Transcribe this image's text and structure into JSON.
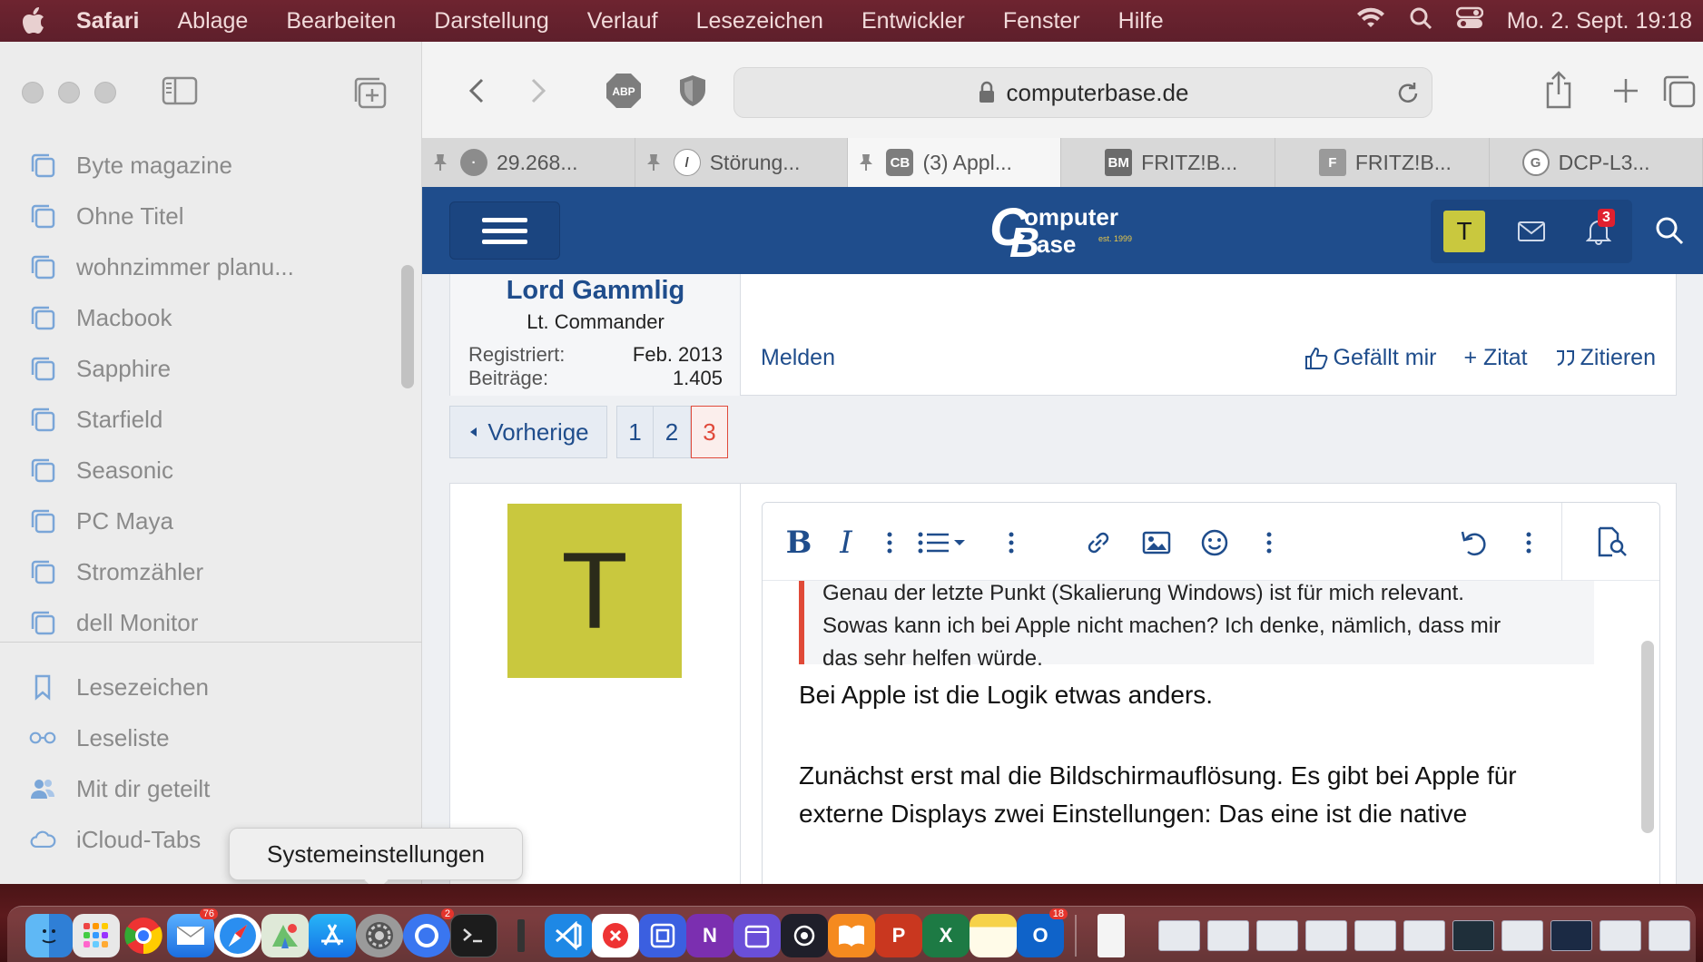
{
  "menubar": {
    "app": "Safari",
    "items": [
      "Ablage",
      "Bearbeiten",
      "Darstellung",
      "Verlauf",
      "Lesezeichen",
      "Entwickler",
      "Fenster",
      "Hilfe"
    ],
    "clock": "Mo. 2. Sept. 19:18"
  },
  "sidebar": {
    "tab_groups": [
      "Byte magazine",
      "Ohne Titel",
      "wohnzimmer planu...",
      "Macbook",
      "Sapphire",
      "Starfield",
      "Seasonic",
      "PC Maya",
      "Stromzähler",
      "dell  Monitor"
    ],
    "lower": [
      {
        "label": "Lesezeichen",
        "icon": "bookmark-icon"
      },
      {
        "label": "Leseliste",
        "icon": "glasses-icon"
      },
      {
        "label": "Mit dir geteilt",
        "icon": "shared-people-icon"
      },
      {
        "label": "iCloud-Tabs",
        "icon": "cloud-icon"
      }
    ],
    "tooltip": "Systemeinstellungen"
  },
  "toolbar": {
    "url": "computerbase.de",
    "abp_label": "ABP"
  },
  "tabs": [
    {
      "label": "29.268...",
      "pinned": true,
      "favicon": "·"
    },
    {
      "label": "Störung...",
      "pinned": true,
      "favicon": "/"
    },
    {
      "label": "(3) Appl...",
      "pinned": true,
      "favicon": "CB",
      "active": true
    },
    {
      "label": "FRITZ!B...",
      "pinned": false,
      "favicon": "BM"
    },
    {
      "label": "FRITZ!B...",
      "pinned": false,
      "favicon": "F"
    },
    {
      "label": "DCP-L3...",
      "pinned": false,
      "favicon": "G"
    }
  ],
  "site": {
    "logo_big_c": "C",
    "logo_omputer": "omputer",
    "logo_big_b": "B",
    "logo_ase": "ase",
    "logo_est": "est. 1999",
    "user_initial": "T",
    "notification_count": "3"
  },
  "post": {
    "author": "Lord Gammlig",
    "rank": "Lt. Commander",
    "registered_label": "Registriert:",
    "registered_value": "Feb. 2013",
    "posts_label": "Beiträge:",
    "posts_value": "1.405",
    "report": "Melden",
    "like": "Gefällt mir",
    "quote_add": "+ Zitat",
    "quote": "Zitieren"
  },
  "pagination": {
    "prev": "Vorherige",
    "pages": [
      "1",
      "2",
      "3"
    ],
    "current": "3"
  },
  "reply": {
    "avatar_initial": "T",
    "quote_lines": [
      "Genau der letzte Punkt (Skalierung Windows) ist für mich relevant.",
      "Sowas kann ich bei Apple nicht machen? Ich denke, nämlich, dass mir",
      "das sehr helfen würde."
    ],
    "body_line1": "Bei Apple ist die Logik etwas anders.",
    "body_line2": "Zunächst erst mal die Bildschirmauflösung. Es gibt bei Apple für",
    "body_line3": "externe Displays zwei Einstellungen: Das eine ist die native"
  },
  "dock": {
    "mail_badge": "76",
    "signal_badge": "2",
    "outlook_badge": "18"
  }
}
